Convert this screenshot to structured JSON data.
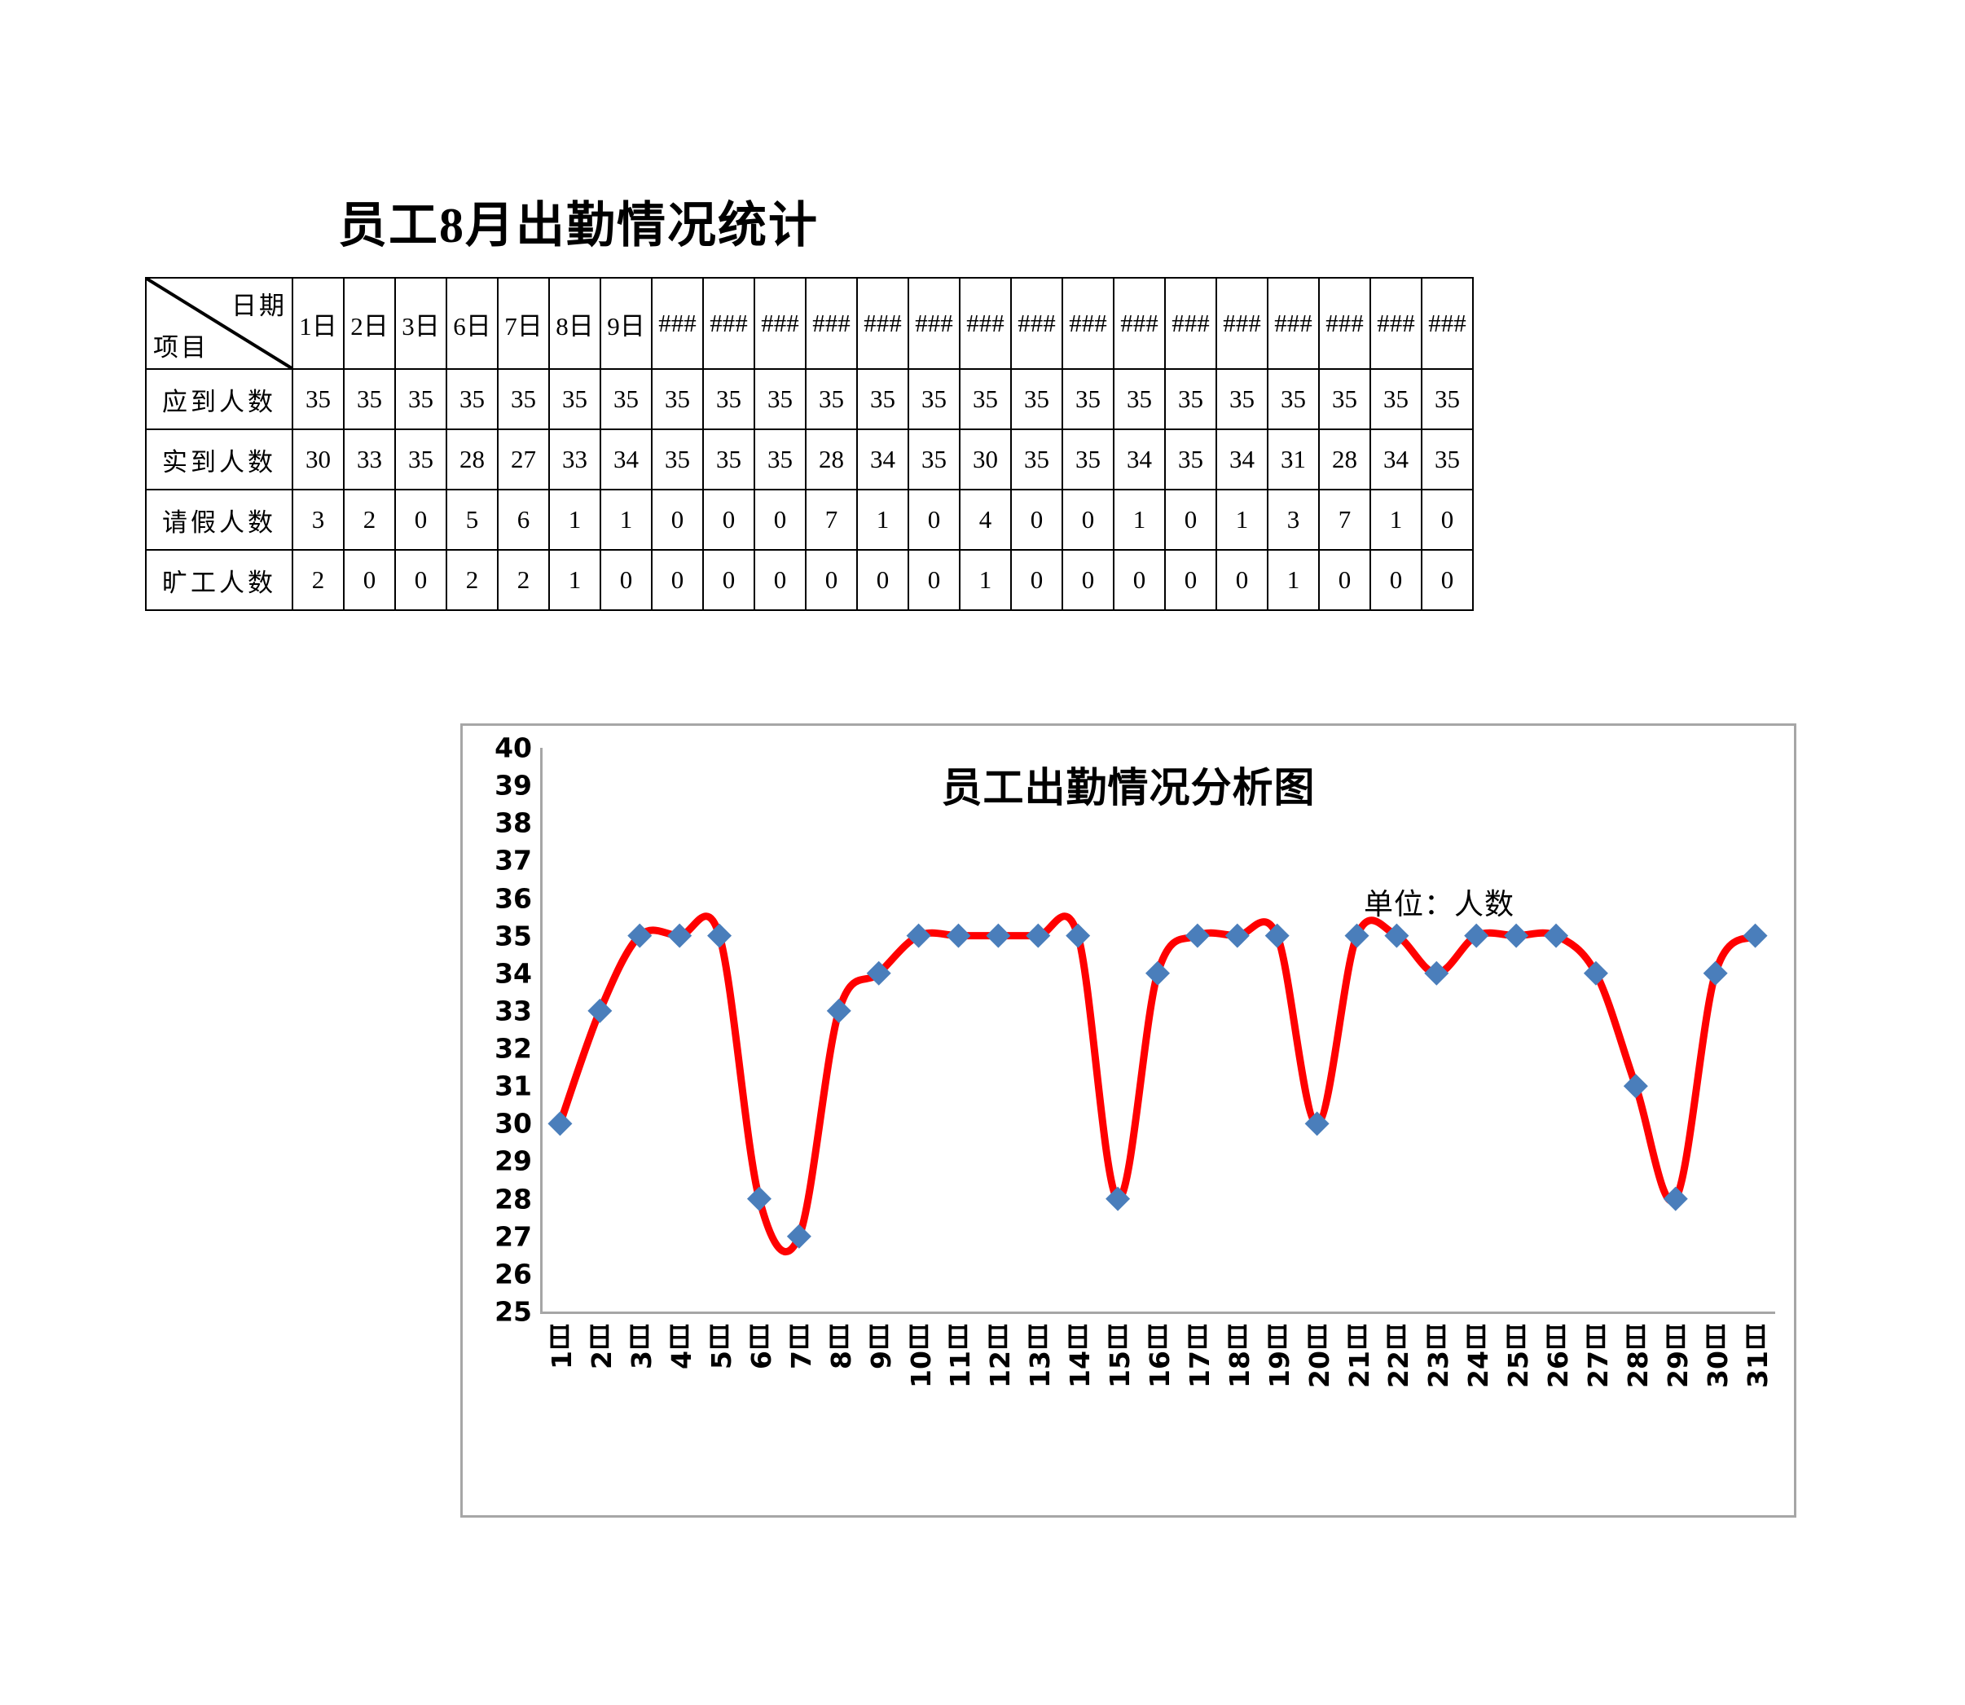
{
  "sheet": {
    "title": "员工8月出勤情况统计"
  },
  "table": {
    "corner": {
      "date_label": "日期",
      "item_label": "项目"
    },
    "day_headers": [
      "1日",
      "2日",
      "3日",
      "6日",
      "7日",
      "8日",
      "9日",
      "###",
      "###",
      "###",
      "###",
      "###",
      "###",
      "###",
      "###",
      "###",
      "###",
      "###",
      "###",
      "###",
      "###",
      "###",
      "###"
    ],
    "rows": [
      {
        "label": "应到人数",
        "values": [
          35,
          35,
          35,
          35,
          35,
          35,
          35,
          35,
          35,
          35,
          35,
          35,
          35,
          35,
          35,
          35,
          35,
          35,
          35,
          35,
          35,
          35,
          35
        ]
      },
      {
        "label": "实到人数",
        "values": [
          30,
          33,
          35,
          28,
          27,
          33,
          34,
          35,
          35,
          35,
          28,
          34,
          35,
          30,
          35,
          35,
          34,
          35,
          34,
          31,
          28,
          34,
          35
        ]
      },
      {
        "label": "请假人数",
        "values": [
          3,
          2,
          0,
          5,
          6,
          1,
          1,
          0,
          0,
          0,
          7,
          1,
          0,
          4,
          0,
          0,
          1,
          0,
          1,
          3,
          7,
          1,
          0
        ]
      },
      {
        "label": "旷工人数",
        "values": [
          2,
          0,
          0,
          2,
          2,
          1,
          0,
          0,
          0,
          0,
          0,
          0,
          0,
          1,
          0,
          0,
          0,
          0,
          0,
          1,
          0,
          0,
          0
        ]
      }
    ]
  },
  "chart_data": {
    "type": "line",
    "title": "员工出勤情况分析图",
    "annotation": "单位：人数",
    "xlabel": "",
    "ylabel": "",
    "ylim": [
      25,
      40
    ],
    "yticks": [
      40,
      39,
      38,
      37,
      36,
      35,
      34,
      33,
      32,
      31,
      30,
      29,
      28,
      27,
      26,
      25
    ],
    "grid": false,
    "legend": "none",
    "smoothed": true,
    "line_color": "#FF0000",
    "marker_color": "#4A7EBB",
    "marker_shape": "diamond",
    "categories": [
      "1日",
      "2日",
      "3日",
      "4日",
      "5日",
      "6日",
      "7日",
      "8日",
      "9日",
      "10日",
      "11日",
      "12日",
      "13日",
      "14日",
      "15日",
      "16日",
      "17日",
      "18日",
      "19日",
      "20日",
      "21日",
      "22日",
      "23日",
      "24日",
      "25日",
      "26日",
      "27日",
      "28日",
      "29日",
      "30日",
      "31日"
    ],
    "series": [
      {
        "name": "实到人数",
        "values": [
          30,
          33,
          35,
          35,
          35,
          28,
          27,
          33,
          34,
          35,
          35,
          35,
          35,
          35,
          28,
          34,
          35,
          35,
          35,
          30,
          35,
          35,
          34,
          35,
          35,
          35,
          34,
          31,
          28,
          34,
          35
        ]
      }
    ]
  }
}
